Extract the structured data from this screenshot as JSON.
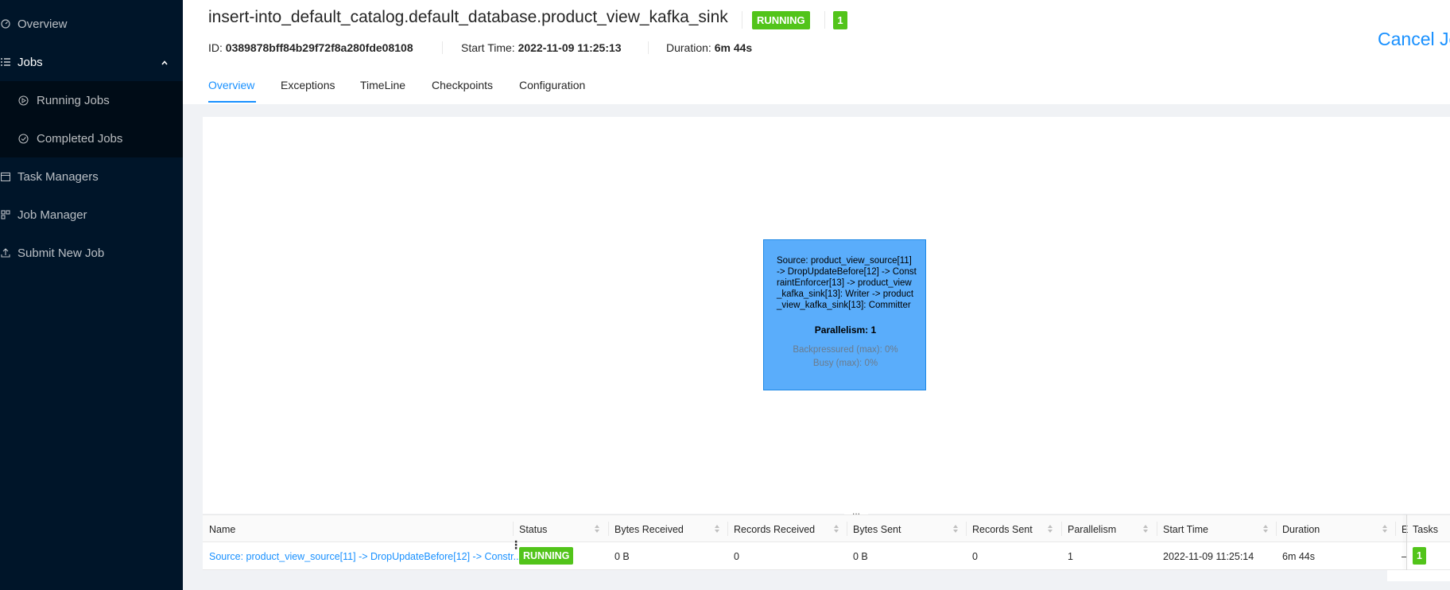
{
  "sidebar": {
    "items": [
      {
        "label": "Overview",
        "icon": "dashboard-icon"
      },
      {
        "label": "Jobs",
        "icon": "list-icon"
      },
      {
        "label": "Running Jobs",
        "icon": "play-circle-icon"
      },
      {
        "label": "Completed Jobs",
        "icon": "check-circle-icon"
      },
      {
        "label": "Task Managers",
        "icon": "schedule-icon"
      },
      {
        "label": "Job Manager",
        "icon": "cluster-icon"
      },
      {
        "label": "Submit New Job",
        "icon": "upload-icon"
      }
    ]
  },
  "job": {
    "title": "insert-into_default_catalog.default_database.product_view_kafka_sink",
    "status": "RUNNING",
    "task_count": "1",
    "id_label": "ID:",
    "id": "0389878bff84b29f72f8a280fde08108",
    "start_label": "Start Time:",
    "start_time": "2022-11-09 11:25:13",
    "duration_label": "Duration:",
    "duration": "6m 44s",
    "cancel_label": "Cancel Jo"
  },
  "tabs": [
    "Overview",
    "Exceptions",
    "TimeLine",
    "Checkpoints",
    "Configuration"
  ],
  "active_tab": "Overview",
  "graph_node": {
    "description": "Source: product_view_source[11] -> DropUpdateBefore[12] -> ConstraintEnforcer[13] -> product_view_kafka_sink[13]: Writer -> product_view_kafka_sink[13]: Committer",
    "parallelism": "Parallelism: 1",
    "backpressured": "Backpressured (max): 0%",
    "busy": "Busy (max): 0%",
    "color": "#5aadfb"
  },
  "resize_handle": "...",
  "table": {
    "headers": [
      "Name",
      "Status",
      "Bytes Received",
      "Records Received",
      "Bytes Sent",
      "Records Sent",
      "Parallelism",
      "Start Time",
      "Duration",
      "E",
      "Tasks"
    ],
    "row": {
      "name": "Source: product_view_source[11] -> DropUpdateBefore[12] -> Constr...",
      "status": "RUNNING",
      "bytes_received": "0 B",
      "records_received": "0",
      "bytes_sent": "0 B",
      "records_sent": "0",
      "parallelism": "1",
      "start_time": "2022-11-09 11:25:14",
      "duration": "6m 44s",
      "end": "–",
      "tasks": "1"
    }
  },
  "colors": {
    "sidebar_bg": "#001529",
    "accent": "#1890ff",
    "running": "#52c41a"
  }
}
